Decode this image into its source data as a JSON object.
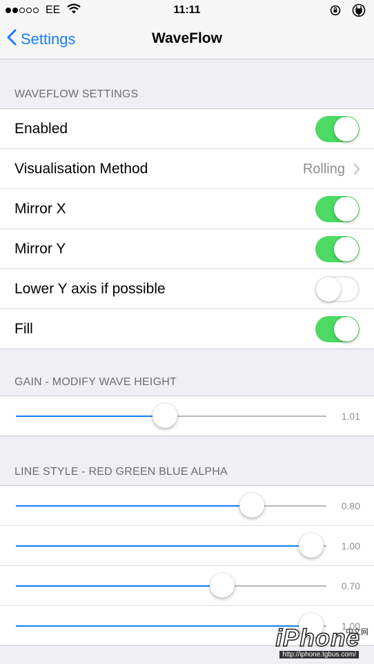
{
  "status_bar": {
    "signal_dots": [
      true,
      true,
      false,
      false,
      false
    ],
    "carrier": "EE",
    "time": "11:11",
    "icons": [
      "wifi-icon",
      "rotation-lock-icon",
      "charging-icon"
    ]
  },
  "nav": {
    "back_label": "Settings",
    "title": "WaveFlow"
  },
  "sections": {
    "waveflow": {
      "header": "WAVEFLOW SETTINGS",
      "rows": [
        {
          "label": "Enabled",
          "type": "toggle",
          "on": true
        },
        {
          "label": "Visualisation Method",
          "type": "disclosure",
          "value": "Rolling"
        },
        {
          "label": "Mirror X",
          "type": "toggle",
          "on": true
        },
        {
          "label": "Mirror Y",
          "type": "toggle",
          "on": true
        },
        {
          "label": "Lower Y axis if possible",
          "type": "toggle",
          "on": false
        },
        {
          "label": "Fill",
          "type": "toggle",
          "on": true
        }
      ]
    },
    "gain": {
      "header": "GAIN - MODIFY WAVE HEIGHT",
      "sliders": [
        {
          "value_label": "1.01",
          "fraction": 0.505
        }
      ]
    },
    "line_style": {
      "header": "LINE STYLE - RED GREEN BLUE ALPHA",
      "sliders": [
        {
          "value_label": "0.80",
          "fraction": 0.8
        },
        {
          "value_label": "1.00",
          "fraction": 1.0
        },
        {
          "value_label": "0.70",
          "fraction": 0.7
        },
        {
          "value_label": "1.00",
          "fraction": 1.0
        }
      ]
    }
  },
  "watermark": {
    "logo": "iPhone",
    "chinese": "中文网",
    "url": "http://iphone.tgbus.com/"
  },
  "colors": {
    "accent": "#157efb",
    "toggle_on": "#4cd964",
    "background": "#efeff4"
  }
}
